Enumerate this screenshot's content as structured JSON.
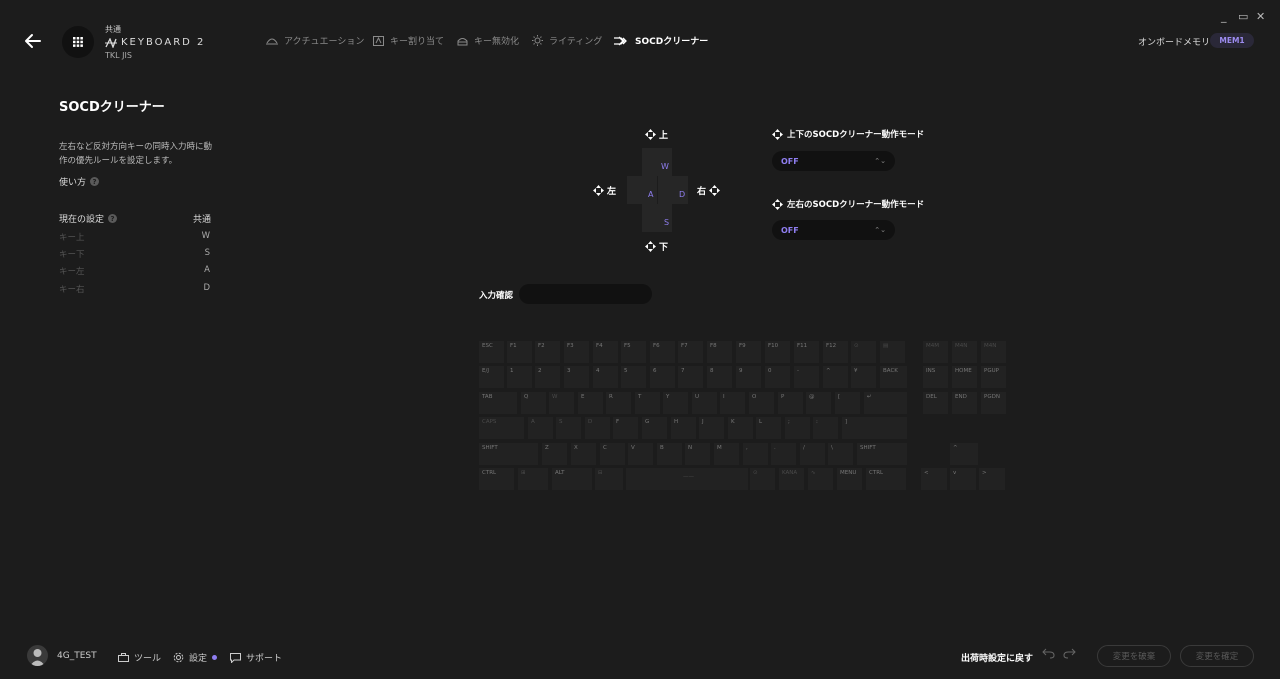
{
  "window": {
    "minimize": "_",
    "maximize": "▭",
    "close": "✕"
  },
  "device": {
    "small_label": "共通",
    "name": "KEYBOARD 2",
    "layout": "TKL JIS"
  },
  "nav": [
    {
      "label": "アクチュエーション",
      "icon": "actuation-icon"
    },
    {
      "label": "キー割り当て",
      "icon": "key-assign-icon"
    },
    {
      "label": "キー無効化",
      "icon": "key-disable-icon"
    },
    {
      "label": "ライティング",
      "icon": "lighting-icon"
    },
    {
      "label": "SOCDクリーナー",
      "icon": "socd-icon",
      "active": true
    }
  ],
  "onboard": {
    "label": "オンボードメモリ",
    "badge": "MEM1"
  },
  "left": {
    "title": "SOCDクリーナー",
    "description": "左右など反対方向キーの同時入力時に動作の優先ルールを設定します。",
    "howto": "使い方",
    "current_label": "現在の設定",
    "current_value": "共通",
    "rows": [
      {
        "key": "キー上",
        "value": "W"
      },
      {
        "key": "キー下",
        "value": "S"
      },
      {
        "key": "キー左",
        "value": "A"
      },
      {
        "key": "キー右",
        "value": "D"
      }
    ]
  },
  "socd": {
    "up": "上",
    "down": "下",
    "left": "左",
    "right": "右",
    "key_up": "W",
    "key_left": "A",
    "key_down": "S",
    "key_right": "D",
    "mode_ud_label": "上下のSOCDクリーナー動作モード",
    "mode_ud_value": "OFF",
    "mode_lr_label": "左右のSOCDクリーナー動作モード",
    "mode_lr_value": "OFF",
    "input_label": "入力確認"
  },
  "keyboard": {
    "row0": [
      "ESC",
      "F1",
      "F2",
      "F3",
      "F4",
      "F5",
      "F6",
      "F7",
      "F8",
      "F9",
      "F10",
      "F11",
      "F12",
      "⊙",
      "▤",
      "M4M",
      "M4N",
      "M4N"
    ],
    "row1": [
      "E/J",
      "1",
      "2",
      "3",
      "4",
      "5",
      "6",
      "7",
      "8",
      "9",
      "0",
      "-",
      "^",
      "¥",
      "BACK",
      "INS",
      "HOME",
      "PGUP"
    ],
    "row2": [
      "TAB",
      "Q",
      "W",
      "E",
      "R",
      "T",
      "Y",
      "U",
      "I",
      "O",
      "P",
      "@",
      "[",
      "↵",
      "DEL",
      "END",
      "PGDN"
    ],
    "row3": [
      "CAPS",
      "A",
      "S",
      "D",
      "F",
      "G",
      "H",
      "J",
      "K",
      "L",
      ";",
      ":",
      "]"
    ],
    "row4": [
      "SHIFT",
      "Z",
      "X",
      "C",
      "V",
      "B",
      "N",
      "M",
      ",",
      ".",
      "/",
      "\\",
      "SHIFT",
      "^"
    ],
    "row5": [
      "CTRL",
      "⊞",
      "ALT",
      "⊟",
      "——",
      "⊙",
      "KANA",
      "∿",
      "MENU",
      "CTRL",
      "<",
      "v",
      ">"
    ]
  },
  "footer": {
    "user": "4G_TEST",
    "tools": "ツール",
    "settings": "設定",
    "support": "サポート",
    "factory": "出荷時設定に戻す",
    "discard": "変更を破棄",
    "confirm": "変更を確定"
  },
  "colors": {
    "accent": "#8f7ef0",
    "bg": "#1c1c1c"
  }
}
